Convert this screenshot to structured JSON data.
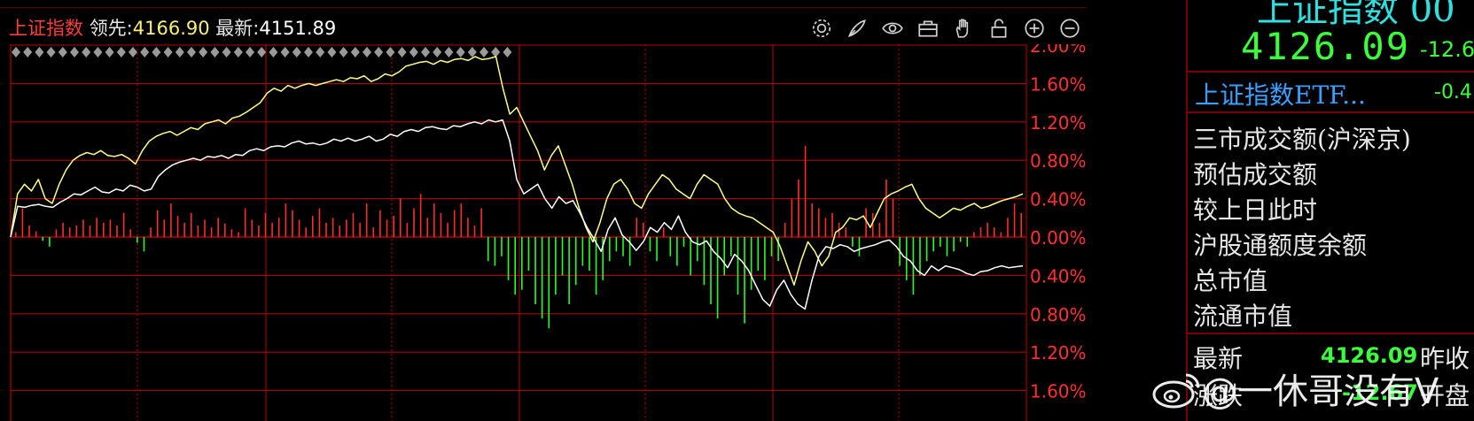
{
  "header": {
    "index_name": "上证指数",
    "leading_label": "领先:",
    "leading_value": "4166.90",
    "latest_label": "最新:",
    "latest_value": "4151.89"
  },
  "toolbar": {
    "icons": [
      "gear-icon",
      "brush-icon",
      "eye-icon",
      "toolbox-icon",
      "hand-icon",
      "lock-icon",
      "zoom-in-icon",
      "zoom-out-icon"
    ]
  },
  "quote_panel": {
    "index_name": "上证指数 00",
    "price": "4126.09",
    "change": "-12.6",
    "etf_name": "上证指数ETF...",
    "etf_change": "-0.4",
    "info_labels": [
      "三市成交额(沪深京)",
      "预估成交额",
      "较上日此时",
      "沪股通额度余额",
      "总市值",
      "流通市值"
    ],
    "latest_label": "最新",
    "latest_value": "4126.09",
    "prev_close_label": "昨收",
    "change_label": "涨跌",
    "change_value": "-12.67",
    "open_label": "开盘"
  },
  "watermark": {
    "text": "@一休哥没有V"
  },
  "chart_data": {
    "type": "line",
    "y_tick_labels": [
      "2.00%",
      "1.60%",
      "1.20%",
      "0.80%",
      "0.40%",
      "0.00%",
      "0.40%",
      "0.80%",
      "1.20%",
      "1.60%"
    ],
    "ylim": [
      -1.6,
      2.0
    ],
    "grid": true,
    "colors": {
      "index_line": "#ffffff",
      "leading_line": "#ffff88",
      "grid": "#b00000",
      "up_bar": "#ff2a2a",
      "down_bar": "#22ff22"
    },
    "series": [
      {
        "values": [
          0.0,
          0.32,
          0.31,
          0.33,
          0.34,
          0.32,
          0.31,
          0.36,
          0.4,
          0.45,
          0.44,
          0.48,
          0.52,
          0.47,
          0.46,
          0.5,
          0.48,
          0.54,
          0.52,
          0.48,
          0.5,
          0.63,
          0.7,
          0.75,
          0.78,
          0.8,
          0.82,
          0.8,
          0.84,
          0.83,
          0.85,
          0.82,
          0.86,
          0.85,
          0.9,
          0.92,
          0.9,
          0.94,
          0.95,
          0.94,
          0.98,
          1.0,
          0.97,
          0.98,
          0.96,
          0.98,
          1.02,
          1.0,
          1.03,
          1.0,
          1.02,
          1.05,
          1.0,
          1.02,
          1.07,
          1.05,
          1.1,
          1.12,
          1.1,
          1.14,
          1.15,
          1.13,
          1.12,
          1.16,
          1.15,
          1.18,
          1.2,
          1.18,
          1.22,
          1.2,
          1.22,
          1.0,
          0.6,
          0.45,
          0.5,
          0.55,
          0.4,
          0.3,
          0.42,
          0.35,
          0.38,
          0.25,
          0.1,
          -0.02,
          -0.15,
          0.08,
          0.2,
          0.02,
          -0.05,
          -0.14,
          -0.05,
          0.1,
          0.05,
          0.15,
          0.08,
          0.22,
          0.05,
          -0.05,
          -0.08,
          -0.04,
          -0.15,
          -0.22,
          -0.32,
          -0.18,
          -0.25,
          -0.35,
          -0.5,
          -0.65,
          -0.72,
          -0.55,
          -0.45,
          -0.6,
          -0.7,
          -0.75,
          -0.45,
          -0.2,
          -0.1,
          -0.12,
          -0.08,
          -0.1,
          -0.15,
          -0.12,
          -0.1,
          -0.08,
          -0.05,
          -0.03,
          -0.1,
          -0.2,
          -0.25,
          -0.35,
          -0.4,
          -0.3,
          -0.35,
          -0.3,
          -0.32,
          -0.34,
          -0.38,
          -0.4,
          -0.36,
          -0.35,
          -0.32,
          -0.3,
          -0.32,
          -0.31,
          -0.3
        ]
      },
      {
        "values": [
          0.0,
          0.45,
          0.55,
          0.48,
          0.6,
          0.4,
          0.35,
          0.55,
          0.7,
          0.8,
          0.85,
          0.88,
          0.86,
          0.9,
          0.85,
          0.84,
          0.86,
          0.82,
          0.76,
          0.9,
          1.0,
          1.05,
          1.08,
          1.1,
          1.06,
          1.1,
          1.14,
          1.12,
          1.18,
          1.2,
          1.22,
          1.18,
          1.24,
          1.26,
          1.3,
          1.35,
          1.4,
          1.5,
          1.55,
          1.52,
          1.58,
          1.55,
          1.58,
          1.6,
          1.58,
          1.6,
          1.62,
          1.64,
          1.62,
          1.66,
          1.65,
          1.68,
          1.62,
          1.65,
          1.7,
          1.68,
          1.72,
          1.78,
          1.8,
          1.82,
          1.83,
          1.8,
          1.84,
          1.82,
          1.85,
          1.86,
          1.84,
          1.88,
          1.85,
          1.86,
          1.88,
          1.55,
          1.28,
          1.35,
          1.2,
          1.05,
          0.9,
          0.7,
          0.85,
          0.95,
          0.75,
          0.55,
          0.3,
          0.1,
          -0.05,
          0.15,
          0.4,
          0.55,
          0.6,
          0.5,
          0.35,
          0.3,
          0.45,
          0.55,
          0.65,
          0.6,
          0.5,
          0.45,
          0.4,
          0.55,
          0.65,
          0.6,
          0.55,
          0.4,
          0.3,
          0.25,
          0.22,
          0.2,
          0.15,
          0.1,
          0.05,
          -0.1,
          -0.3,
          -0.5,
          -0.25,
          -0.05,
          -0.15,
          -0.3,
          -0.2,
          0.05,
          0.1,
          0.2,
          0.18,
          0.22,
          0.1,
          0.25,
          0.4,
          0.45,
          0.48,
          0.52,
          0.55,
          0.4,
          0.3,
          0.25,
          0.2,
          0.25,
          0.3,
          0.28,
          0.32,
          0.35,
          0.3,
          0.32,
          0.35,
          0.38,
          0.4,
          0.42,
          0.45
        ]
      }
    ],
    "bars": [
      0.05,
      0.3,
      0.12,
      0.06,
      -0.04,
      -0.1,
      0.08,
      0.15,
      0.1,
      0.12,
      0.18,
      0.12,
      0.2,
      0.15,
      0.18,
      0.12,
      0.25,
      0.08,
      -0.06,
      -0.15,
      0.1,
      0.28,
      0.18,
      0.35,
      0.22,
      0.15,
      0.25,
      0.12,
      0.18,
      0.1,
      0.2,
      0.14,
      0.08,
      0.05,
      0.3,
      0.18,
      0.12,
      0.25,
      0.15,
      0.2,
      0.35,
      0.28,
      0.18,
      0.1,
      0.22,
      0.3,
      0.15,
      0.2,
      0.12,
      0.18,
      0.25,
      0.15,
      0.35,
      0.1,
      0.28,
      0.18,
      0.22,
      0.4,
      0.15,
      0.3,
      0.45,
      0.2,
      0.35,
      0.25,
      0.15,
      0.28,
      0.35,
      0.2,
      0.12,
      0.3,
      -0.25,
      -0.3,
      -0.2,
      -0.45,
      -0.6,
      -0.55,
      -0.35,
      -0.7,
      -0.85,
      -0.95,
      -0.6,
      -0.4,
      -0.7,
      -0.5,
      -0.3,
      -0.35,
      -0.6,
      -0.45,
      -0.25,
      -0.15,
      -0.2,
      -0.3,
      0.2,
      0.15,
      -0.15,
      -0.25,
      0.1,
      -0.2,
      -0.3,
      -0.1,
      -0.4,
      -0.25,
      -0.5,
      -0.7,
      -0.85,
      -0.4,
      -0.2,
      -0.6,
      -0.9,
      -0.55,
      -0.35,
      -0.45,
      -0.2,
      -0.25,
      0.15,
      0.4,
      0.6,
      0.95,
      0.35,
      0.3,
      0.2,
      0.25,
      0.15,
      0.1,
      -0.1,
      -0.2,
      0.3,
      0.25,
      0.15,
      0.6,
      0.4,
      -0.3,
      -0.45,
      -0.6,
      -0.4,
      -0.25,
      -0.15,
      -0.1,
      -0.2,
      -0.15,
      -0.05,
      -0.1,
      0.05,
      0.1,
      0.15,
      0.1,
      0.05,
      0.2,
      0.35,
      0.25
    ]
  }
}
